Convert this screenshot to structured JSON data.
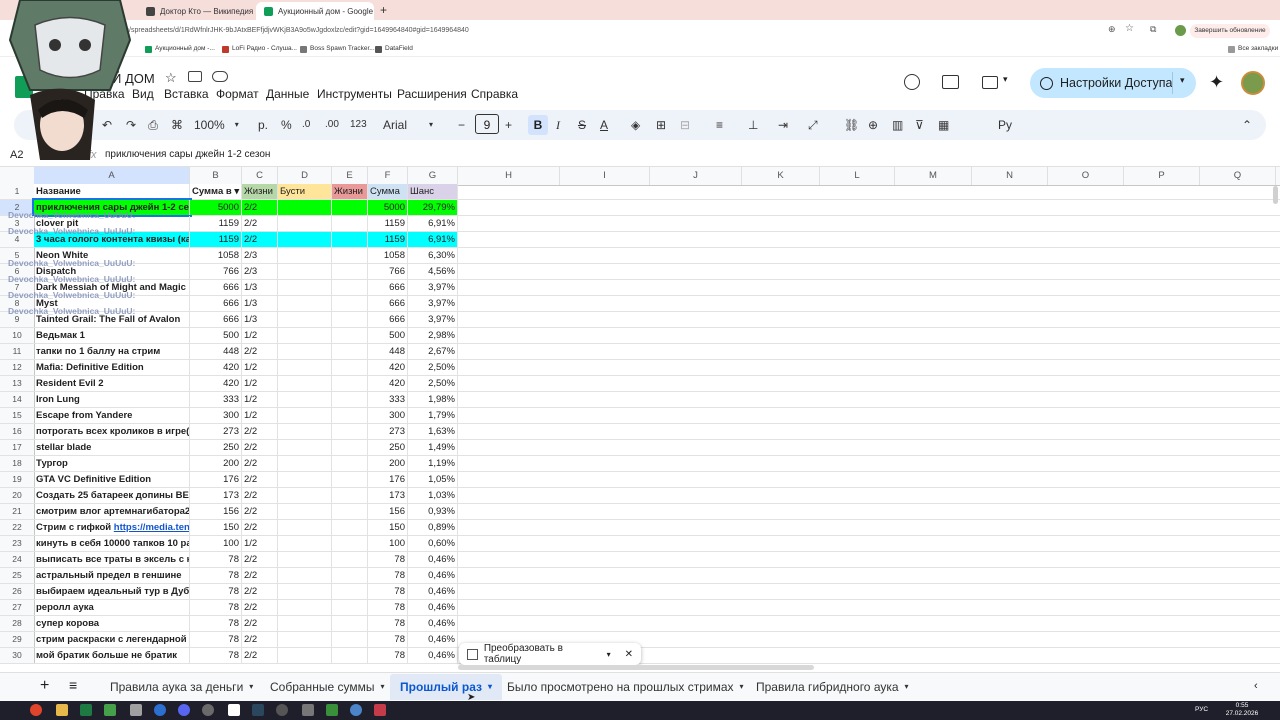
{
  "browser": {
    "tabs": [
      {
        "title": "Доктор Кто — Википедия",
        "active": false
      },
      {
        "title": "Аукционный дом - Google Та",
        "active": true
      }
    ],
    "url": "...com/spreadsheets/d/1RdWfnlrJHK-9bJAtxBEFfjdjvWKjB3A9o5wJgdoxlzc/edit?gid=1649964840#gid=1649964840",
    "update_button": "Завершить обновление",
    "bookmarks": [
      "Аукционный дом -...",
      "LoFi Радио - Слуша...",
      "Boss Spawn Tracker...",
      "DataField"
    ],
    "all_bookmarks": "Все закладки"
  },
  "sheets": {
    "doc_title": "Й ДОМ",
    "menu": [
      "Правка",
      "Вид",
      "Вставка",
      "Формат",
      "Данные",
      "Инструменты",
      "Расширения",
      "Справка"
    ],
    "share_button": "Настройки Доступа",
    "toolbar": {
      "zoom": "100%",
      "currency": "р.",
      "percent": "%",
      "dec_decrease": ".0",
      "dec_increase": ".00",
      "number_format": "123",
      "font": "Arial",
      "font_size": "9",
      "bold": "B"
    },
    "name_box": "A2",
    "fx": "fx",
    "formula": "приключения сары джейн 1-2 сезон"
  },
  "grid": {
    "columns": [
      "A",
      "B",
      "C",
      "D",
      "E",
      "F",
      "G",
      "H",
      "I",
      "J",
      "K",
      "L",
      "M",
      "N",
      "O",
      "P",
      "Q"
    ],
    "headers": [
      "Название",
      "Сумма в ▾",
      "Жизни",
      "Бусти",
      "Жизни",
      "Сумма",
      "Шанс"
    ],
    "rows": [
      {
        "n": "2",
        "name": "приключения сары джейн 1-2 сезон",
        "sum": "5000",
        "lives": "2/2",
        "total": "5000",
        "chance": "29,79%",
        "hl": "green"
      },
      {
        "n": "3",
        "name": "clover pit",
        "sum": "1159",
        "lives": "2/2",
        "total": "1159",
        "chance": "6,91%",
        "hl": ""
      },
      {
        "n": "4",
        "name": "3 часа голого контента квизы (ка",
        "sum": "1159",
        "lives": "2/2",
        "total": "1159",
        "chance": "6,91%",
        "hl": "cyan"
      },
      {
        "n": "5",
        "name": "Neon White",
        "sum": "1058",
        "lives": "2/3",
        "total": "1058",
        "chance": "6,30%",
        "hl": ""
      },
      {
        "n": "6",
        "name": "Dispatch",
        "sum": "766",
        "lives": "2/3",
        "total": "766",
        "chance": "4,56%",
        "hl": ""
      },
      {
        "n": "7",
        "name": "Dark Messiah of Might and Magic",
        "sum": "666",
        "lives": "1/3",
        "total": "666",
        "chance": "3,97%",
        "hl": ""
      },
      {
        "n": "8",
        "name": "Myst",
        "sum": "666",
        "lives": "1/3",
        "total": "666",
        "chance": "3,97%",
        "hl": ""
      },
      {
        "n": "9",
        "name": "Tainted Grail: The Fall of Avalon",
        "sum": "666",
        "lives": "1/3",
        "total": "666",
        "chance": "3,97%",
        "hl": ""
      },
      {
        "n": "10",
        "name": "Ведьмак 1",
        "sum": "500",
        "lives": "1/2",
        "total": "500",
        "chance": "2,98%",
        "hl": ""
      },
      {
        "n": "11",
        "name": "тапки по 1 баллу на стрим",
        "sum": "448",
        "lives": "2/2",
        "total": "448",
        "chance": "2,67%",
        "hl": ""
      },
      {
        "n": "12",
        "name": "Mafia: Definitive Edition",
        "sum": "420",
        "lives": "1/2",
        "total": "420",
        "chance": "2,50%",
        "hl": ""
      },
      {
        "n": "13",
        "name": "Resident Evil 2",
        "sum": "420",
        "lives": "1/2",
        "total": "420",
        "chance": "2,50%",
        "hl": ""
      },
      {
        "n": "14",
        "name": "Iron Lung",
        "sum": "333",
        "lives": "1/2",
        "total": "333",
        "chance": "1,98%",
        "hl": ""
      },
      {
        "n": "15",
        "name": "Escape from Yandere",
        "sum": "300",
        "lives": "1/2",
        "total": "300",
        "chance": "1,79%",
        "hl": ""
      },
      {
        "n": "16",
        "name": "потрогать всех кроликов в игре(пр",
        "sum": "273",
        "lives": "2/2",
        "total": "273",
        "chance": "1,63%",
        "hl": ""
      },
      {
        "n": "17",
        "name": "stellar blade",
        "sum": "250",
        "lives": "2/2",
        "total": "250",
        "chance": "1,49%",
        "hl": ""
      },
      {
        "n": "18",
        "name": "Тургор",
        "sum": "200",
        "lives": "2/2",
        "total": "200",
        "chance": "1,19%",
        "hl": ""
      },
      {
        "n": "19",
        "name": "GTA VC Definitive Edition",
        "sum": "176",
        "lives": "2/2",
        "total": "176",
        "chance": "1,05%",
        "hl": ""
      },
      {
        "n": "20",
        "name": "Создать 25 батареек допины ВЕ, к",
        "sum": "173",
        "lives": "2/2",
        "total": "173",
        "chance": "1,03%",
        "hl": ""
      },
      {
        "n": "21",
        "name": "смотрим влог артемнагибатора200",
        "sum": "156",
        "lives": "2/2",
        "total": "156",
        "chance": "0,93%",
        "hl": ""
      },
      {
        "n": "22",
        "name": "Стрим с гифкой ",
        "link": "https://media.tenor",
        "sum": "150",
        "lives": "2/2",
        "total": "150",
        "chance": "0,89%",
        "hl": ""
      },
      {
        "n": "23",
        "name": "кинуть в себя 10000 тапков 10 раз",
        "sum": "100",
        "lives": "1/2",
        "total": "100",
        "chance": "0,60%",
        "hl": ""
      },
      {
        "n": "24",
        "name": "выписать все траты в эксель с ка",
        "sum": "78",
        "lives": "2/2",
        "total": "78",
        "chance": "0,46%",
        "hl": ""
      },
      {
        "n": "25",
        "name": "астральный предел в геншине",
        "sum": "78",
        "lives": "2/2",
        "total": "78",
        "chance": "0,46%",
        "hl": ""
      },
      {
        "n": "26",
        "name": "выбираем идеальный тур в Дубай",
        "sum": "78",
        "lives": "2/2",
        "total": "78",
        "chance": "0,46%",
        "hl": ""
      },
      {
        "n": "27",
        "name": "реролл аука",
        "sum": "78",
        "lives": "2/2",
        "total": "78",
        "chance": "0,46%",
        "hl": ""
      },
      {
        "n": "28",
        "name": "супер корова",
        "sum": "78",
        "lives": "2/2",
        "total": "78",
        "chance": "0,46%",
        "hl": ""
      },
      {
        "n": "29",
        "name": "стрим раскраски с легендарной по",
        "sum": "78",
        "lives": "2/2",
        "total": "78",
        "chance": "0,46%",
        "hl": ""
      },
      {
        "n": "30",
        "name": "мой братик больше не братик",
        "sum": "78",
        "lives": "2/2",
        "total": "78",
        "chance": "0,46%",
        "hl": ""
      }
    ],
    "overlay_user": "Devochka_Volwebnica_UuUuU:"
  },
  "convert_popup": "Преобразовать в таблицу",
  "sheet_tabs": [
    {
      "label": "Правила аука за деньги",
      "active": false
    },
    {
      "label": "Собранные суммы",
      "active": false
    },
    {
      "label": "Прошлый раз",
      "active": true
    },
    {
      "label": "Было просмотрено на прошлых стримах",
      "active": false
    },
    {
      "label": "Правила гибридного аука",
      "active": false
    }
  ],
  "taskbar": {
    "lang": "РУС",
    "time": "0:55",
    "date": "27.02.2026"
  }
}
